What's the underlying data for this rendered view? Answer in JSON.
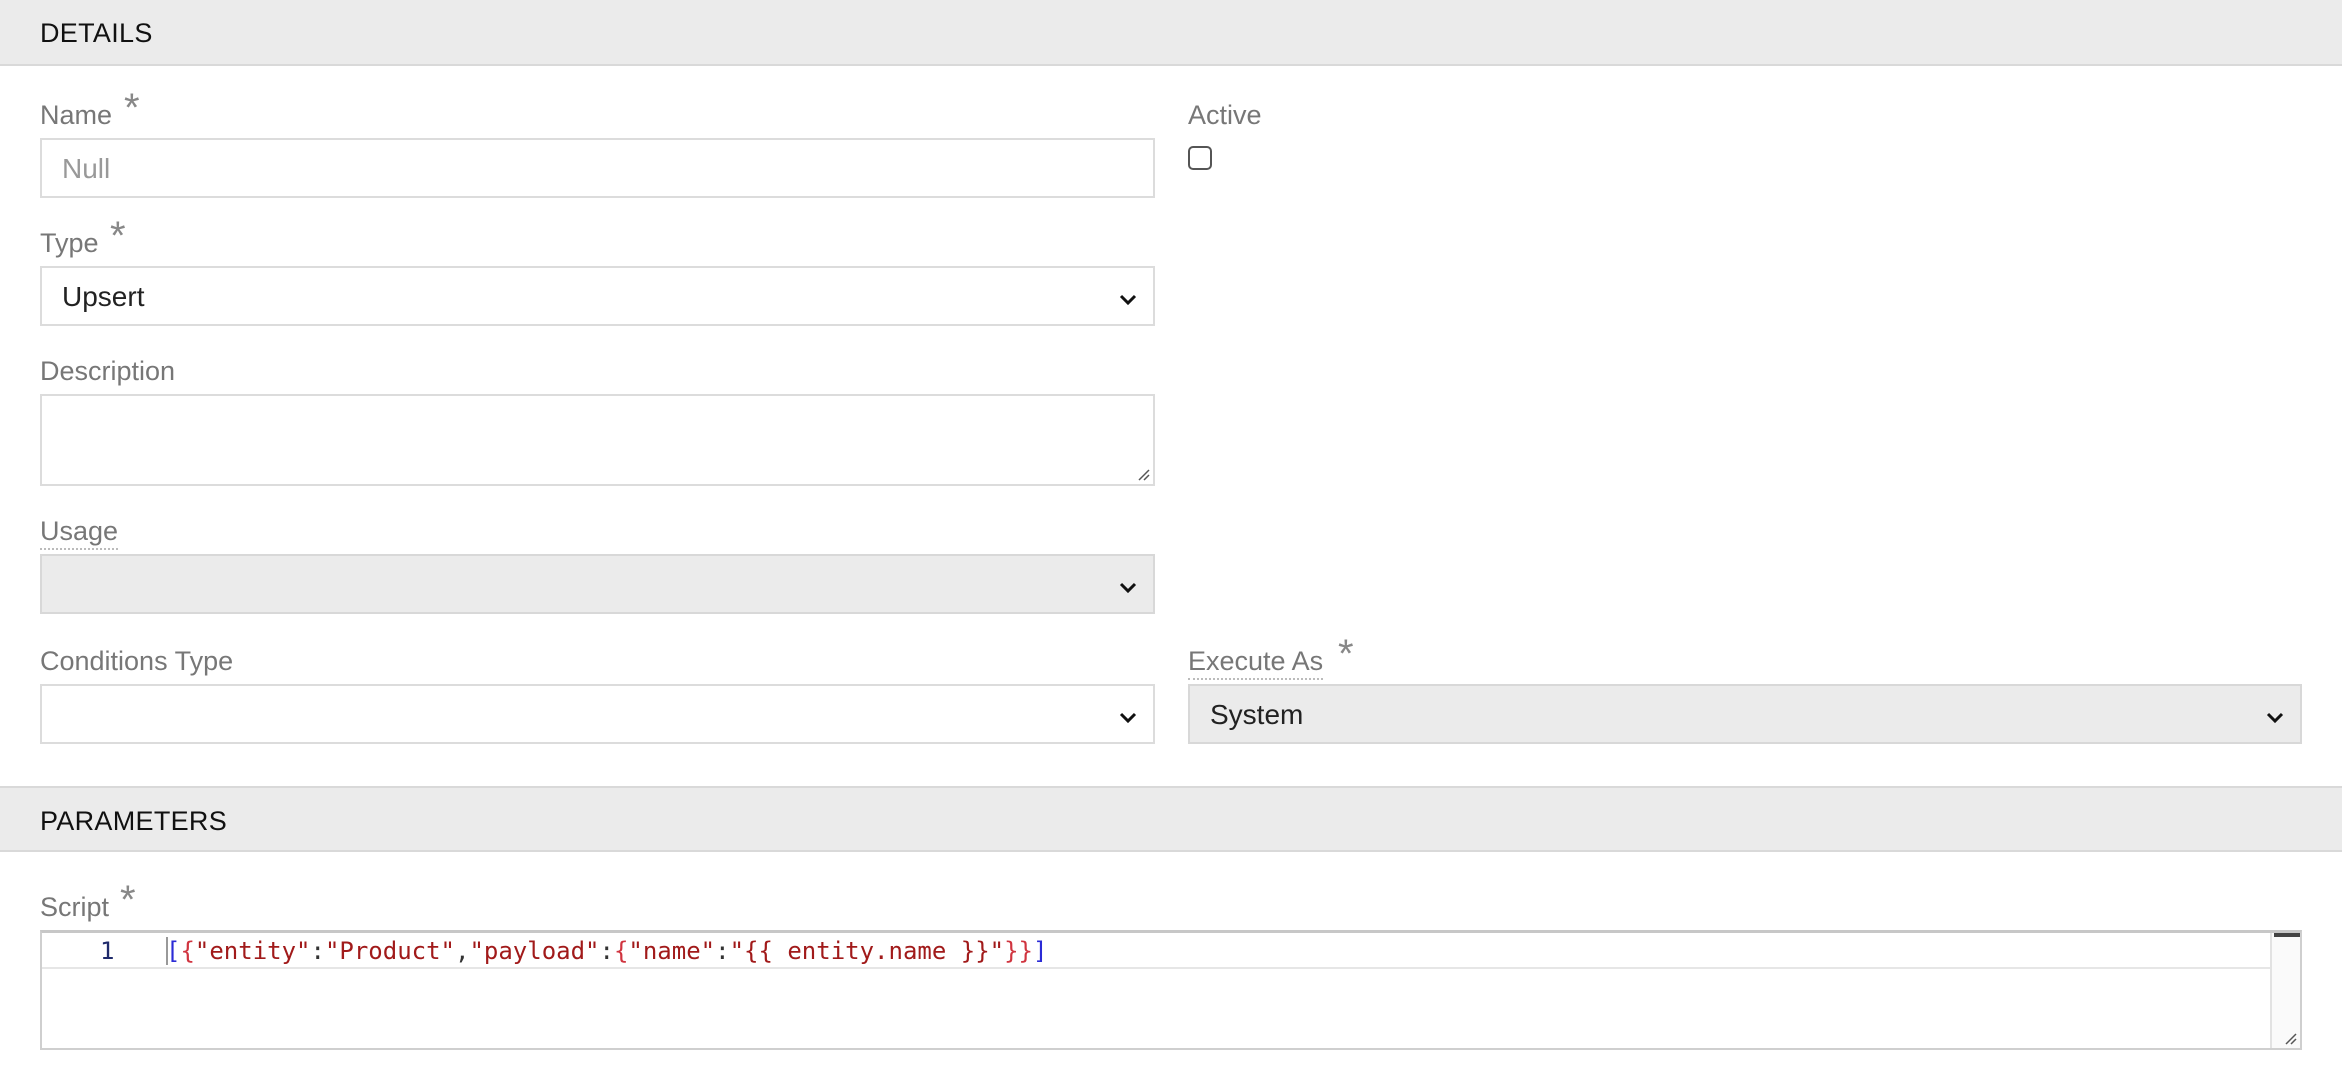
{
  "sections": {
    "details": "DETAILS",
    "parameters": "PARAMETERS"
  },
  "fields": {
    "name": {
      "label": "Name",
      "required_mark": "*",
      "placeholder": "Null",
      "value": ""
    },
    "active": {
      "label": "Active",
      "checked": false
    },
    "type": {
      "label": "Type",
      "required_mark": "*",
      "value": "Upsert"
    },
    "description": {
      "label": "Description",
      "value": ""
    },
    "usage": {
      "label": "Usage",
      "value": ""
    },
    "conditions_type": {
      "label": "Conditions Type",
      "value": ""
    },
    "execute_as": {
      "label": "Execute As",
      "required_mark": "*",
      "value": "System"
    },
    "script": {
      "label": "Script",
      "required_mark": "*",
      "line_number": "1",
      "code": "[{\"entity\":\"Product\",\"payload\":{\"name\":\"{{ entity.name }}\"}}]"
    }
  },
  "icons": {
    "select_arrow": "chevron-down-icon",
    "textarea_resize": "resize-handle-icon"
  },
  "colors": {
    "section_bg": "#ebebeb",
    "label": "#777777",
    "disabled_field_bg": "#ebebeb",
    "code_string": "#a11a1a",
    "code_bracket": "#2b2bd6",
    "code_brace": "#d0343f"
  }
}
